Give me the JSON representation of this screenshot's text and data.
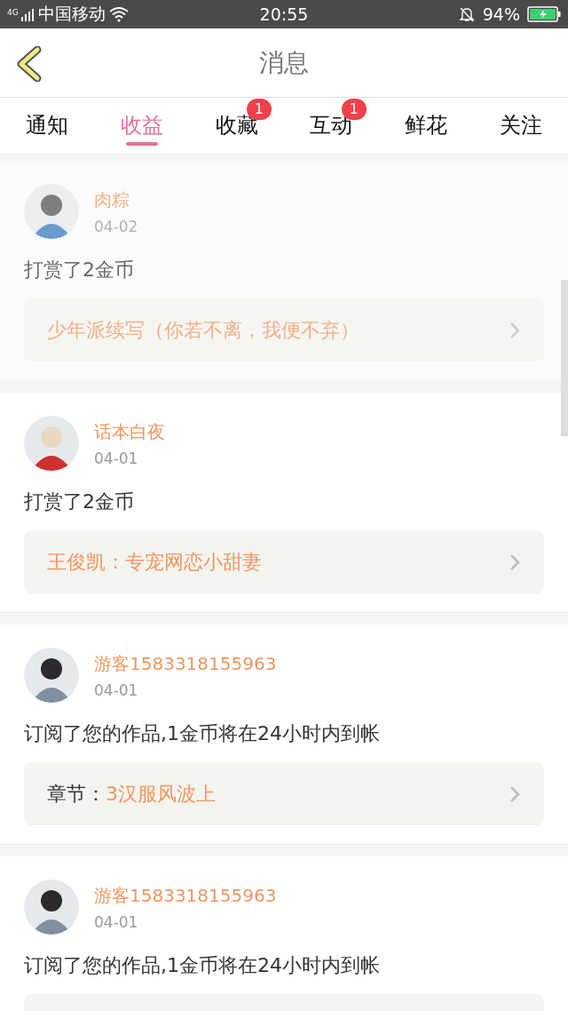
{
  "status_bar": {
    "network": "4G",
    "carrier": "中国移动",
    "time": "20:55",
    "battery": "94%"
  },
  "header": {
    "title": "消息"
  },
  "tabs": [
    {
      "label": "通知",
      "selected": false
    },
    {
      "label": "收益",
      "selected": true
    },
    {
      "label": "收藏",
      "selected": false,
      "badge": "1"
    },
    {
      "label": "互动",
      "selected": false,
      "badge": "1"
    },
    {
      "label": "鲜花",
      "selected": false
    },
    {
      "label": "关注",
      "selected": false
    }
  ],
  "messages": [
    {
      "name": "肉粽",
      "date": "04-02",
      "text": "打赏了2金币",
      "pressed": true,
      "link": {
        "title": "少年派续写（你若不离，我便不弃）"
      }
    },
    {
      "name": "话本白夜",
      "date": "04-01",
      "text": "打赏了2金币",
      "pressed": false,
      "link": {
        "title": "王俊凯：专宠网恋小甜妻"
      }
    },
    {
      "name": "游客1583318155963",
      "date": "04-01",
      "text": "订阅了您的作品,1金币将在24小时内到帐",
      "pressed": false,
      "link": {
        "label": "章节：",
        "title": "3汉服风波上"
      }
    },
    {
      "name": "游客1583318155963",
      "date": "04-01",
      "text": "订阅了您的作品,1金币将在24小时内到帐",
      "pressed": false
    }
  ]
}
